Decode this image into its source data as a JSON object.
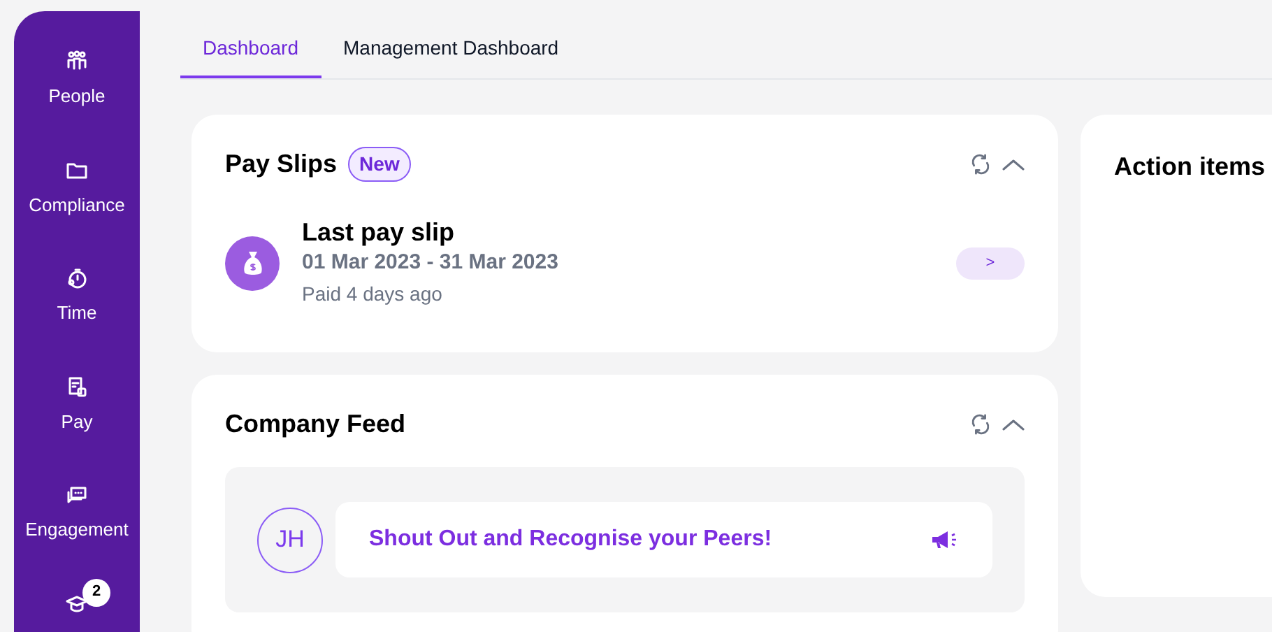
{
  "sidebar": {
    "items": [
      {
        "kind": "people",
        "label": "People"
      },
      {
        "kind": "folder",
        "label": "Compliance"
      },
      {
        "kind": "time",
        "label": "Time"
      },
      {
        "kind": "pay",
        "label": "Pay"
      },
      {
        "kind": "engagement",
        "label": "Engagement"
      },
      {
        "kind": "learning",
        "badge": "2"
      }
    ]
  },
  "tabs": [
    {
      "label": "Dashboard",
      "selected": true
    },
    {
      "label": "Management Dashboard",
      "selected": false
    }
  ],
  "pay_slips": {
    "title": "Pay Slips",
    "badge": "New",
    "item": {
      "title": "Last pay slip",
      "period": "01 Mar 2023 - 31 Mar 2023",
      "paid": "Paid 4 days ago",
      "button": ">"
    }
  },
  "company_feed": {
    "title": "Company Feed",
    "avatar": "JH",
    "prompt": "Shout Out and Recognise your Peers!"
  },
  "action_items": {
    "title": "Action items"
  }
}
